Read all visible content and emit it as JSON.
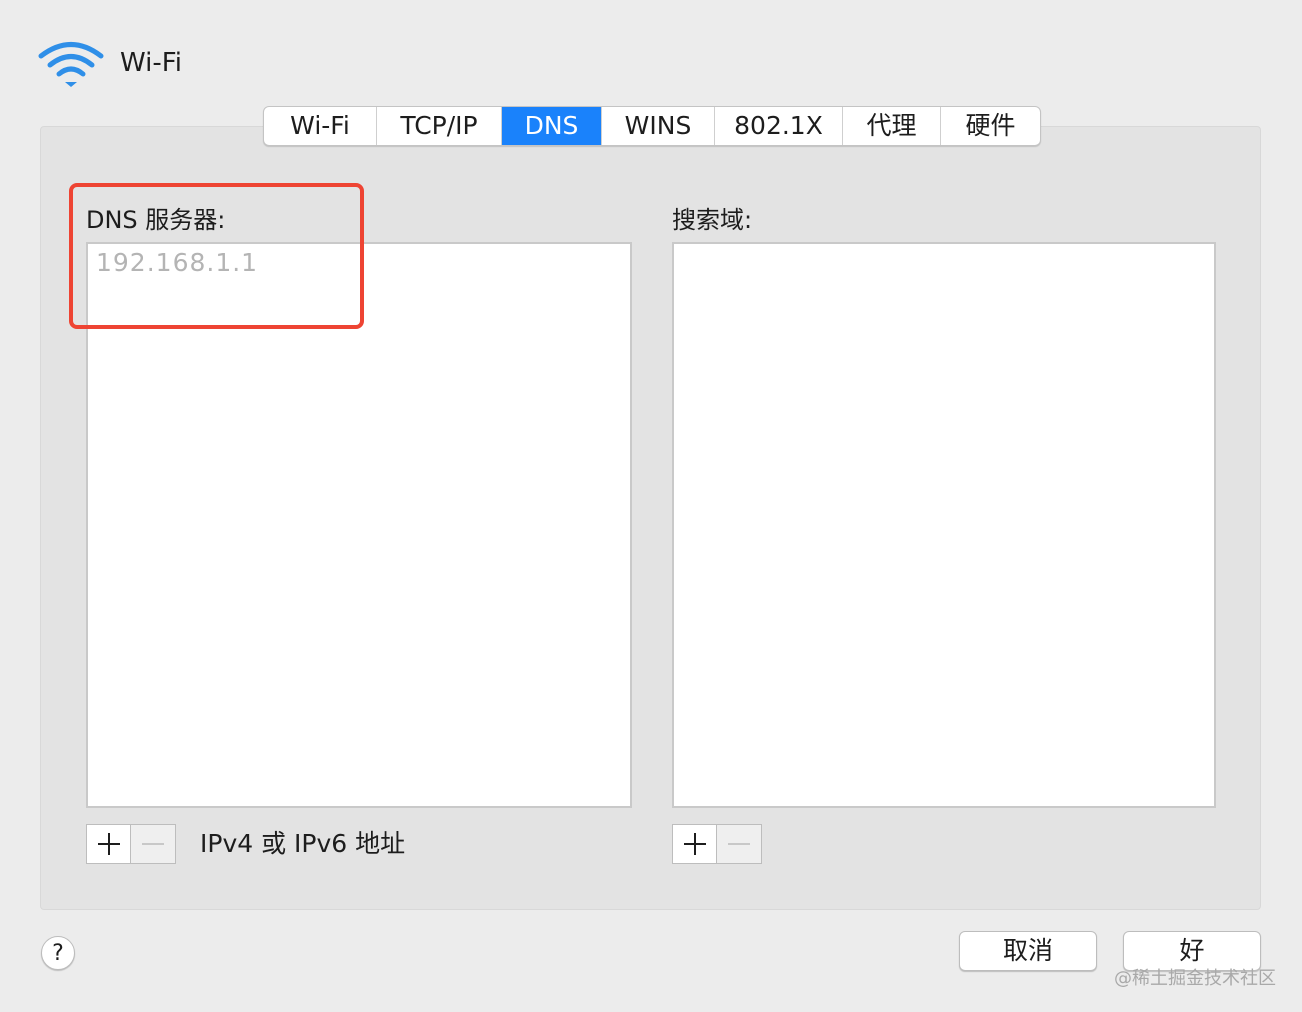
{
  "window": {
    "title": "Wi-Fi"
  },
  "tabs": [
    {
      "label": "Wi-Fi",
      "active": false
    },
    {
      "label": "TCP/IP",
      "active": false
    },
    {
      "label": "DNS",
      "active": true
    },
    {
      "label": "WINS",
      "active": false
    },
    {
      "label": "802.1X",
      "active": false
    },
    {
      "label": "代理",
      "active": false
    },
    {
      "label": "硬件",
      "active": false
    }
  ],
  "dns_servers": {
    "label": "DNS 服务器:",
    "entries": [
      "192.168.1.1"
    ],
    "hint": "IPv4 或 IPv6 地址"
  },
  "search_domains": {
    "label": "搜索域:",
    "entries": []
  },
  "buttons": {
    "help": "?",
    "cancel": "取消",
    "ok": "好"
  },
  "watermark": "@稀土掘金技术社区",
  "colors": {
    "accent": "#1a82fb",
    "highlight": "#ee4433",
    "background": "#ececec"
  }
}
